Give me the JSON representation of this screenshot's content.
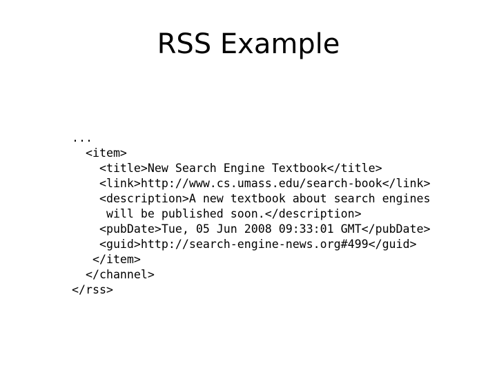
{
  "slide": {
    "title": "RSS Example",
    "background_color": "#ffffff",
    "text_color": "#000000"
  },
  "code": {
    "language": "xml",
    "lines": [
      "...",
      "  <item>",
      "    <title>New Search Engine Textbook</title>",
      "    <link>http://www.cs.umass.edu/search-book</link>",
      "    <description>A new textbook about search engines",
      "     will be published soon.</description>",
      "    <pubDate>Tue, 05 Jun 2008 09:33:01 GMT</pubDate>",
      "    <guid>http://search-engine-news.org#499</guid>",
      "   </item>",
      "  </channel>",
      "</rss>"
    ]
  }
}
